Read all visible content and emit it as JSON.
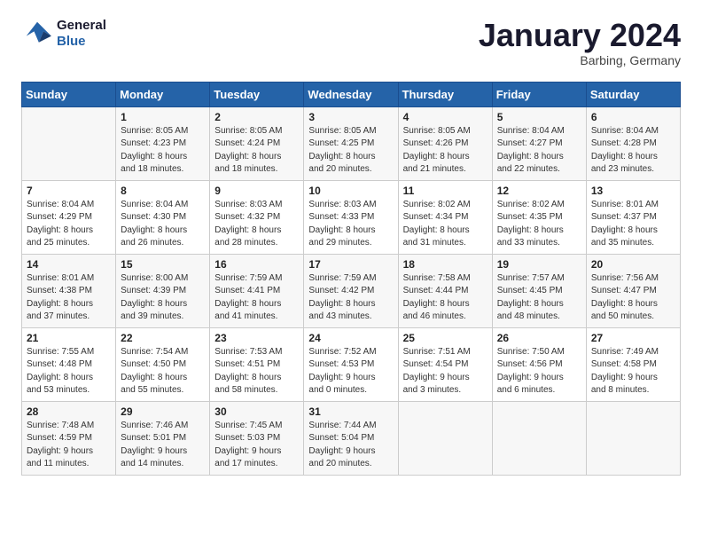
{
  "header": {
    "logo_line1": "General",
    "logo_line2": "Blue",
    "month": "January 2024",
    "location": "Barbing, Germany"
  },
  "days_of_week": [
    "Sunday",
    "Monday",
    "Tuesday",
    "Wednesday",
    "Thursday",
    "Friday",
    "Saturday"
  ],
  "weeks": [
    [
      {
        "day": "",
        "info": ""
      },
      {
        "day": "1",
        "info": "Sunrise: 8:05 AM\nSunset: 4:23 PM\nDaylight: 8 hours\nand 18 minutes."
      },
      {
        "day": "2",
        "info": "Sunrise: 8:05 AM\nSunset: 4:24 PM\nDaylight: 8 hours\nand 18 minutes."
      },
      {
        "day": "3",
        "info": "Sunrise: 8:05 AM\nSunset: 4:25 PM\nDaylight: 8 hours\nand 20 minutes."
      },
      {
        "day": "4",
        "info": "Sunrise: 8:05 AM\nSunset: 4:26 PM\nDaylight: 8 hours\nand 21 minutes."
      },
      {
        "day": "5",
        "info": "Sunrise: 8:04 AM\nSunset: 4:27 PM\nDaylight: 8 hours\nand 22 minutes."
      },
      {
        "day": "6",
        "info": "Sunrise: 8:04 AM\nSunset: 4:28 PM\nDaylight: 8 hours\nand 23 minutes."
      }
    ],
    [
      {
        "day": "7",
        "info": "Sunrise: 8:04 AM\nSunset: 4:29 PM\nDaylight: 8 hours\nand 25 minutes."
      },
      {
        "day": "8",
        "info": "Sunrise: 8:04 AM\nSunset: 4:30 PM\nDaylight: 8 hours\nand 26 minutes."
      },
      {
        "day": "9",
        "info": "Sunrise: 8:03 AM\nSunset: 4:32 PM\nDaylight: 8 hours\nand 28 minutes."
      },
      {
        "day": "10",
        "info": "Sunrise: 8:03 AM\nSunset: 4:33 PM\nDaylight: 8 hours\nand 29 minutes."
      },
      {
        "day": "11",
        "info": "Sunrise: 8:02 AM\nSunset: 4:34 PM\nDaylight: 8 hours\nand 31 minutes."
      },
      {
        "day": "12",
        "info": "Sunrise: 8:02 AM\nSunset: 4:35 PM\nDaylight: 8 hours\nand 33 minutes."
      },
      {
        "day": "13",
        "info": "Sunrise: 8:01 AM\nSunset: 4:37 PM\nDaylight: 8 hours\nand 35 minutes."
      }
    ],
    [
      {
        "day": "14",
        "info": "Sunrise: 8:01 AM\nSunset: 4:38 PM\nDaylight: 8 hours\nand 37 minutes."
      },
      {
        "day": "15",
        "info": "Sunrise: 8:00 AM\nSunset: 4:39 PM\nDaylight: 8 hours\nand 39 minutes."
      },
      {
        "day": "16",
        "info": "Sunrise: 7:59 AM\nSunset: 4:41 PM\nDaylight: 8 hours\nand 41 minutes."
      },
      {
        "day": "17",
        "info": "Sunrise: 7:59 AM\nSunset: 4:42 PM\nDaylight: 8 hours\nand 43 minutes."
      },
      {
        "day": "18",
        "info": "Sunrise: 7:58 AM\nSunset: 4:44 PM\nDaylight: 8 hours\nand 46 minutes."
      },
      {
        "day": "19",
        "info": "Sunrise: 7:57 AM\nSunset: 4:45 PM\nDaylight: 8 hours\nand 48 minutes."
      },
      {
        "day": "20",
        "info": "Sunrise: 7:56 AM\nSunset: 4:47 PM\nDaylight: 8 hours\nand 50 minutes."
      }
    ],
    [
      {
        "day": "21",
        "info": "Sunrise: 7:55 AM\nSunset: 4:48 PM\nDaylight: 8 hours\nand 53 minutes."
      },
      {
        "day": "22",
        "info": "Sunrise: 7:54 AM\nSunset: 4:50 PM\nDaylight: 8 hours\nand 55 minutes."
      },
      {
        "day": "23",
        "info": "Sunrise: 7:53 AM\nSunset: 4:51 PM\nDaylight: 8 hours\nand 58 minutes."
      },
      {
        "day": "24",
        "info": "Sunrise: 7:52 AM\nSunset: 4:53 PM\nDaylight: 9 hours\nand 0 minutes."
      },
      {
        "day": "25",
        "info": "Sunrise: 7:51 AM\nSunset: 4:54 PM\nDaylight: 9 hours\nand 3 minutes."
      },
      {
        "day": "26",
        "info": "Sunrise: 7:50 AM\nSunset: 4:56 PM\nDaylight: 9 hours\nand 6 minutes."
      },
      {
        "day": "27",
        "info": "Sunrise: 7:49 AM\nSunset: 4:58 PM\nDaylight: 9 hours\nand 8 minutes."
      }
    ],
    [
      {
        "day": "28",
        "info": "Sunrise: 7:48 AM\nSunset: 4:59 PM\nDaylight: 9 hours\nand 11 minutes."
      },
      {
        "day": "29",
        "info": "Sunrise: 7:46 AM\nSunset: 5:01 PM\nDaylight: 9 hours\nand 14 minutes."
      },
      {
        "day": "30",
        "info": "Sunrise: 7:45 AM\nSunset: 5:03 PM\nDaylight: 9 hours\nand 17 minutes."
      },
      {
        "day": "31",
        "info": "Sunrise: 7:44 AM\nSunset: 5:04 PM\nDaylight: 9 hours\nand 20 minutes."
      },
      {
        "day": "",
        "info": ""
      },
      {
        "day": "",
        "info": ""
      },
      {
        "day": "",
        "info": ""
      }
    ]
  ]
}
